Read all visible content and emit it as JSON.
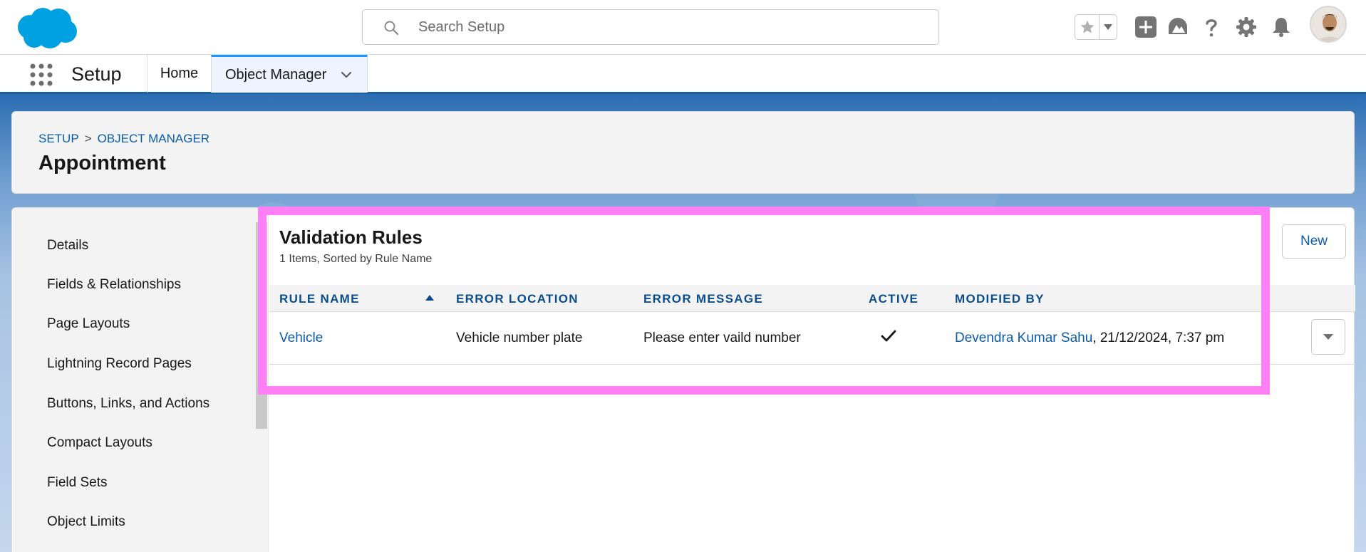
{
  "global_header": {
    "search_placeholder": "Search Setup"
  },
  "nav": {
    "app_name": "Setup",
    "tabs": [
      {
        "label": "Home"
      },
      {
        "label": "Object Manager"
      }
    ]
  },
  "page_header": {
    "breadcrumb": [
      "SETUP",
      "OBJECT MANAGER"
    ],
    "breadcrumb_sep": ">",
    "title": "Appointment"
  },
  "sidebar": {
    "items": [
      {
        "label": "Details"
      },
      {
        "label": "Fields & Relationships"
      },
      {
        "label": "Page Layouts"
      },
      {
        "label": "Lightning Record Pages"
      },
      {
        "label": "Buttons, Links, and Actions"
      },
      {
        "label": "Compact Layouts"
      },
      {
        "label": "Field Sets"
      },
      {
        "label": "Object Limits"
      }
    ]
  },
  "main": {
    "section_title": "Validation Rules",
    "section_subtitle": "1 Items, Sorted by Rule Name",
    "new_button_label": "New",
    "columns": [
      "Rule Name",
      "Error Location",
      "Error Message",
      "Active",
      "Modified By"
    ],
    "rows": [
      {
        "rule_name": "Vehicle",
        "error_location": "Vehicle number plate",
        "error_message": "Please enter vaild number",
        "active": true,
        "modified_by_name": "Devendra Kumar Sahu",
        "modified_by_date": ", 21/12/2024, 7:37 pm"
      }
    ]
  },
  "colors": {
    "brand_blue": "#1b96ff",
    "link_blue": "#0b5cab",
    "highlight_pink": "#ff80f5",
    "nav_underline": "#1b5f9e"
  },
  "icons": [
    "salesforce-cloud-logo",
    "search-icon",
    "star-icon",
    "favorites-dropdown-icon",
    "add-icon",
    "trailhead-icon",
    "help-icon",
    "gear-icon",
    "bell-icon",
    "app-launcher-icon",
    "chevron-down-icon",
    "sort-ascending-icon",
    "checkmark-icon",
    "row-action-dropdown-icon"
  ]
}
